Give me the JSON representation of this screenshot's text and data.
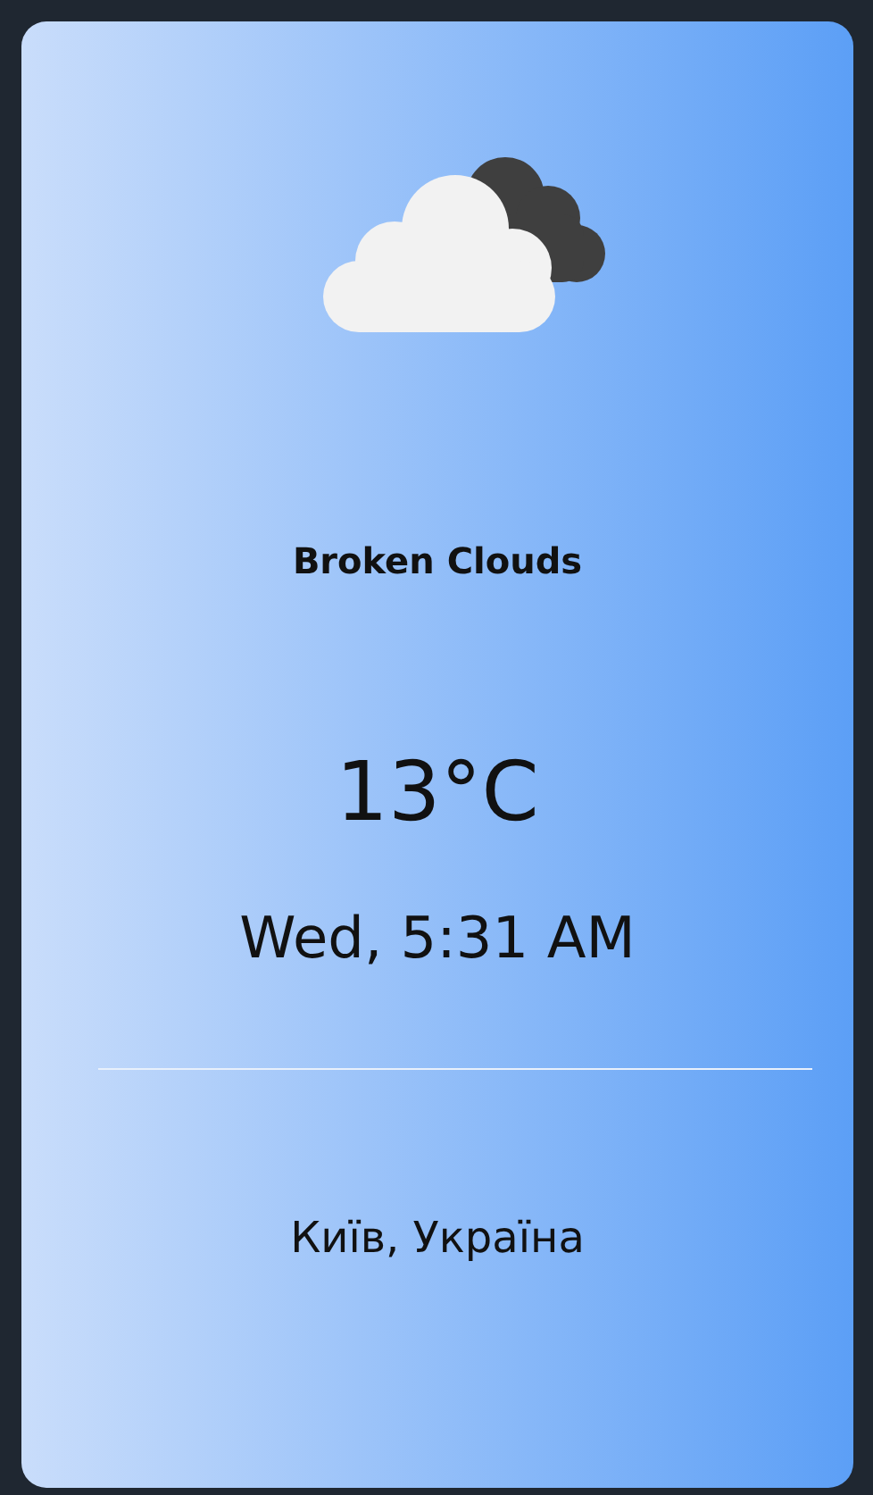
{
  "weather": {
    "condition": "Broken Clouds",
    "temperature": "13°C",
    "datetime": "Wed, 5:31 AM",
    "location": "Київ, Україна"
  }
}
